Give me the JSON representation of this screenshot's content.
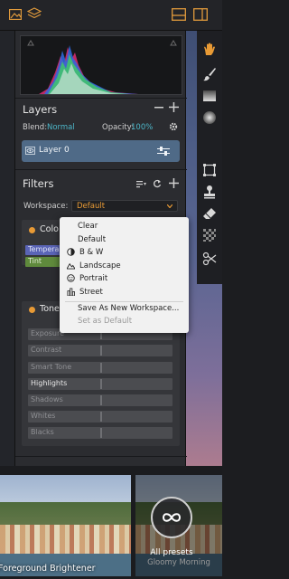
{
  "histogram": {
    "label": "histogram"
  },
  "layers": {
    "title": "Layers",
    "blend_label": "Blend:",
    "blend_value": "Normal",
    "opacity_label": "Opacity:",
    "opacity_value": "100%",
    "layer_name": "Layer 0"
  },
  "filters": {
    "title": "Filters",
    "workspace_label": "Workspace:",
    "workspace_value": "Default",
    "color_card_label": "Colo",
    "color_tab_1": "Tempera",
    "color_tab_2": "Tint",
    "tone_card_label": "Tone",
    "sliders": [
      "Exposure",
      "Contrast",
      "Smart Tone",
      "Highlights",
      "Shadows",
      "Whites",
      "Blacks"
    ],
    "active_slider": "Highlights"
  },
  "workspace_menu": {
    "items": [
      "Clear",
      "Default",
      "B & W",
      "Landscape",
      "Portrait",
      "Street"
    ],
    "save_label": "Save As New Workspace...",
    "set_default_label": "Set as Default"
  },
  "presets": {
    "thumb_1_caption": "Foreground Brightener",
    "thumb_2_caption": "Gloomy Morning",
    "all_presets_label": "All presets"
  },
  "colors": {
    "accent": "#e89a35",
    "teal": "#4db6c8",
    "layer_row": "#4f6a87"
  }
}
